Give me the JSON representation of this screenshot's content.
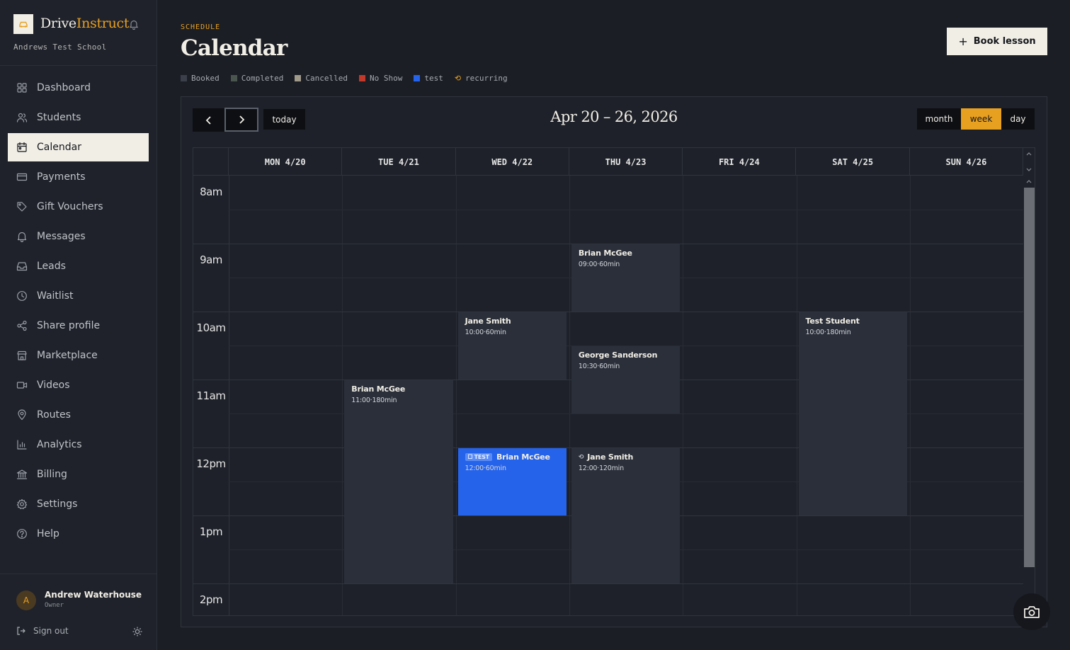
{
  "brand": {
    "name_a": "Drive",
    "name_b": "Instruct",
    "school": "Andrews Test School",
    "accent": "#e8a020"
  },
  "nav": [
    {
      "label": "Dashboard",
      "icon": "dashboard-icon"
    },
    {
      "label": "Students",
      "icon": "students-icon"
    },
    {
      "label": "Calendar",
      "icon": "calendar-icon",
      "active": true
    },
    {
      "label": "Payments",
      "icon": "payments-icon"
    },
    {
      "label": "Gift Vouchers",
      "icon": "tag-icon"
    },
    {
      "label": "Messages",
      "icon": "bell-icon"
    },
    {
      "label": "Leads",
      "icon": "inbox-icon"
    },
    {
      "label": "Waitlist",
      "icon": "clock-icon"
    },
    {
      "label": "Share profile",
      "icon": "share-icon"
    },
    {
      "label": "Marketplace",
      "icon": "store-icon"
    },
    {
      "label": "Videos",
      "icon": "video-icon"
    },
    {
      "label": "Routes",
      "icon": "map-pin-icon"
    },
    {
      "label": "Analytics",
      "icon": "chart-icon"
    },
    {
      "label": "Billing",
      "icon": "bank-icon"
    },
    {
      "label": "Settings",
      "icon": "gear-icon"
    },
    {
      "label": "Help",
      "icon": "help-icon"
    }
  ],
  "user": {
    "initial": "A",
    "name": "Andrew Waterhouse",
    "role": "Owner",
    "signout": "Sign out"
  },
  "header": {
    "eyebrow": "SCHEDULE",
    "title": "Calendar",
    "book_label": "Book lesson"
  },
  "legend": [
    {
      "label": "Booked",
      "color": "#3a3f4a"
    },
    {
      "label": "Completed",
      "color": "#4a5550"
    },
    {
      "label": "Cancelled",
      "color": "#a09a8a"
    },
    {
      "label": "No Show",
      "color": "#c0392b"
    },
    {
      "label": "test",
      "color": "#2563eb"
    }
  ],
  "legend_recurring": "recurring",
  "toolbar": {
    "today": "today",
    "range": "Apr 20 – 26, 2026",
    "views": [
      "month",
      "week",
      "day"
    ],
    "active_view": "week"
  },
  "days": [
    "MON 4/20",
    "TUE 4/21",
    "WED 4/22",
    "THU 4/23",
    "FRI 4/24",
    "SAT 4/25",
    "SUN 4/26"
  ],
  "hours": [
    "8am",
    "9am",
    "10am",
    "11am",
    "12pm",
    "1pm",
    "2pm"
  ],
  "events": [
    {
      "day": 3,
      "start": 9.0,
      "duration_min": 60,
      "title": "Brian McGee",
      "meta": "09:00·60min",
      "type": "booked"
    },
    {
      "day": 2,
      "start": 10.0,
      "duration_min": 60,
      "title": "Jane Smith",
      "meta": "10:00·60min",
      "type": "booked"
    },
    {
      "day": 3,
      "start": 10.5,
      "duration_min": 60,
      "title": "George Sanderson",
      "meta": "10:30·60min",
      "type": "booked"
    },
    {
      "day": 5,
      "start": 10.0,
      "duration_min": 180,
      "title": "Test Student",
      "meta": "10:00·180min",
      "type": "booked"
    },
    {
      "day": 1,
      "start": 11.0,
      "duration_min": 180,
      "title": "Brian McGee",
      "meta": "11:00·180min",
      "type": "booked"
    },
    {
      "day": 2,
      "start": 12.0,
      "duration_min": 60,
      "title": "Brian McGee",
      "meta": "12:00·60min",
      "type": "test",
      "badge": "TEST"
    },
    {
      "day": 3,
      "start": 12.0,
      "duration_min": 120,
      "title": "Jane Smith",
      "meta": "12:00·120min",
      "type": "booked",
      "recurring": true
    }
  ]
}
